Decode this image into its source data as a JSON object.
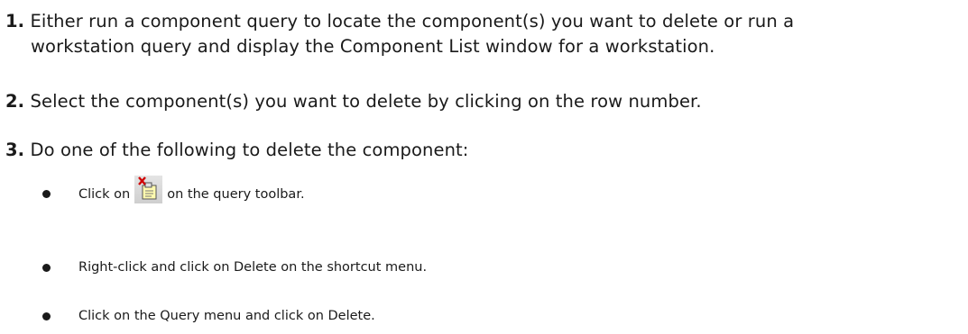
{
  "steps": [
    {
      "number": "1.",
      "line1": "Either run a component query to locate the component(s) you want to delete or run a",
      "line2": "workstation query and display the Component List window for a workstation."
    },
    {
      "number": "2.",
      "line1": "Select the component(s) you want to delete by clicking on the row number."
    },
    {
      "number": "3.",
      "line1": "Do one of the following to delete the component:"
    }
  ],
  "bullets": [
    {
      "before": "Click on",
      "icon": "delete-document-icon",
      "after": "on the query toolbar."
    },
    {
      "text": "Right-click and click on Delete on the shortcut menu."
    },
    {
      "text": "Click on the Query menu and click on Delete."
    }
  ]
}
